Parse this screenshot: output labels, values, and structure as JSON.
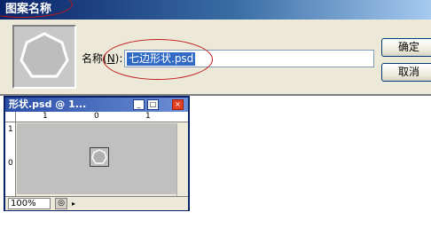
{
  "dialog": {
    "title": "图案名称",
    "name_label": "名称(",
    "name_mnemonic": "N",
    "name_label_end": "):",
    "name_value": "七边形状.psd",
    "ok_label": "确定",
    "cancel_label": "取消"
  },
  "document": {
    "title": "形状.psd @ 1...",
    "zoom": "100%",
    "ruler": {
      "top_labels": [
        "1",
        "0",
        "1"
      ],
      "left_labels": [
        "1",
        "0"
      ]
    },
    "window_buttons": {
      "min_icon": "minimize-icon",
      "max_icon": "maximize-icon",
      "close_icon": "close-icon"
    }
  },
  "colors": {
    "annotation_red": "#c01818",
    "selection_blue": "#316ac5",
    "titlebar_blue": "#0a246a"
  }
}
